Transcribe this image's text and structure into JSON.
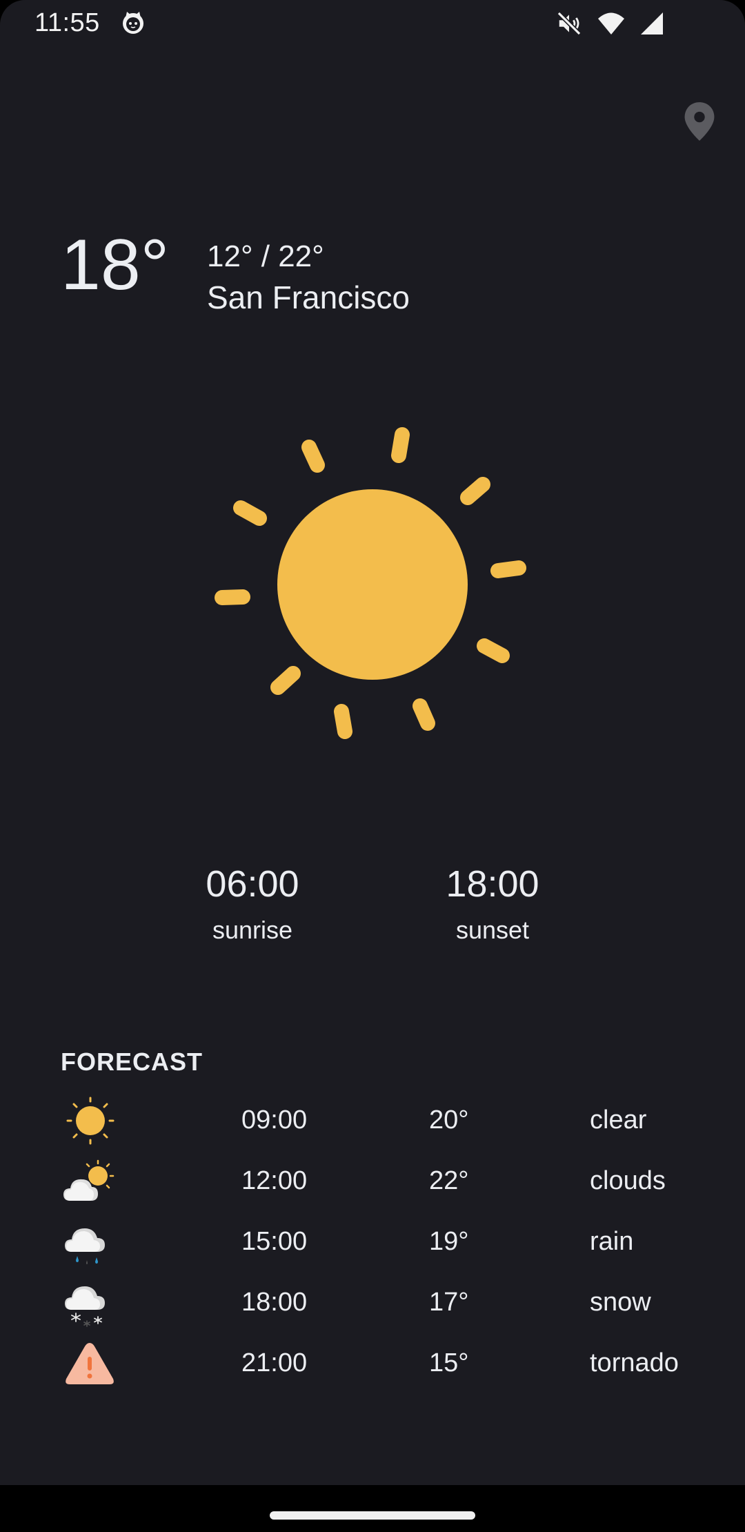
{
  "status_bar": {
    "time": "11:55",
    "icons": [
      "cat-app-icon",
      "mute-icon",
      "wifi-icon",
      "signal-icon"
    ]
  },
  "current": {
    "temperature": "18°",
    "range": "12° / 22°",
    "city": "San Francisco",
    "condition_icon": "sun-icon"
  },
  "sun": {
    "sunrise_time": "06:00",
    "sunrise_label": "sunrise",
    "sunset_time": "18:00",
    "sunset_label": "sunset"
  },
  "forecast": {
    "heading": "FORECAST",
    "items": [
      {
        "time": "09:00",
        "temp": "20°",
        "condition": "clear",
        "icon": "clear-icon"
      },
      {
        "time": "12:00",
        "temp": "22°",
        "condition": "clouds",
        "icon": "clouds-icon"
      },
      {
        "time": "15:00",
        "temp": "19°",
        "condition": "rain",
        "icon": "rain-icon"
      },
      {
        "time": "18:00",
        "temp": "17°",
        "condition": "snow",
        "icon": "snow-icon"
      },
      {
        "time": "21:00",
        "temp": "15°",
        "condition": "tornado",
        "icon": "tornado-warning-icon"
      }
    ]
  },
  "colors": {
    "background": "#1b1b21",
    "sun": "#f3bd4c",
    "text": "#eceef2",
    "pin": "#5b5b60",
    "warning": "#f7b9a0",
    "warning_mark": "#f0743c",
    "rain": "#2e95c9"
  }
}
